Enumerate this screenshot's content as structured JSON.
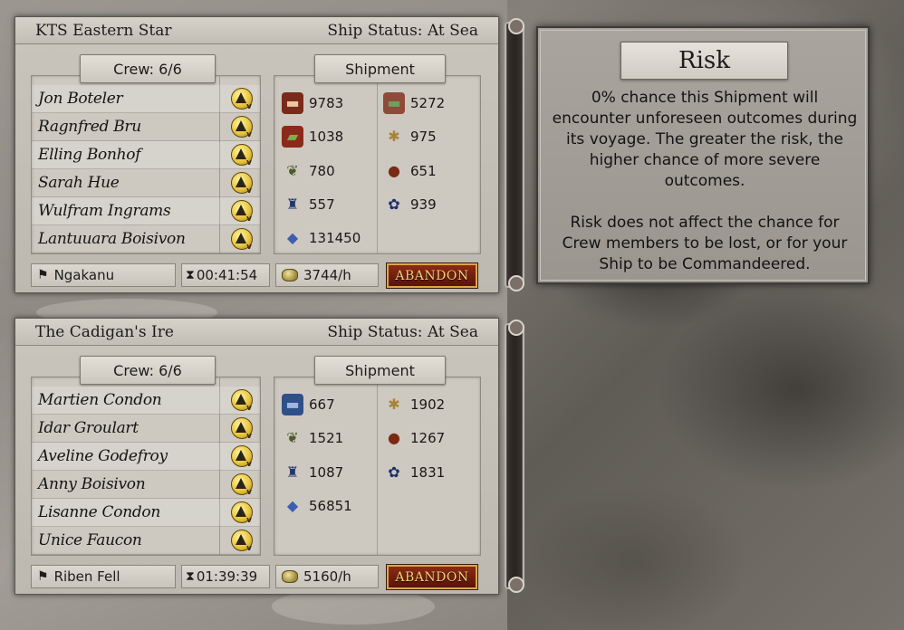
{
  "ships": [
    {
      "name": "KTS Eastern Star",
      "status": "Ship Status: At Sea",
      "crew_label": "Crew: 6/6",
      "shipment_label": "Shipment",
      "crew": [
        "Jon Boteler",
        "Ragnfred Bru",
        "Elling Bonhof",
        "Sarah Hue",
        "Wulfram Ingrams",
        "Lantuuara Boisivon"
      ],
      "cargo_left": [
        {
          "icon": "wood-log-icon",
          "value": "9783"
        },
        {
          "icon": "cloth-bolt-icon",
          "value": "1038"
        },
        {
          "icon": "herb-icon",
          "value": "780"
        },
        {
          "icon": "crystal-flask-icon",
          "value": "557"
        },
        {
          "icon": "gem-pile-icon",
          "value": "131450"
        }
      ],
      "cargo_right": [
        {
          "icon": "plank-icon",
          "value": "5272"
        },
        {
          "icon": "wheat-icon",
          "value": "975"
        },
        {
          "icon": "fruit-icon",
          "value": "651"
        },
        {
          "icon": "ore-cluster-icon",
          "value": "939"
        }
      ],
      "destination": "Ngakanu",
      "timer": "00:41:54",
      "rate": "3744/h",
      "abandon_label": "ABANDON"
    },
    {
      "name": "The Cadigan's Ire",
      "status": "Ship Status: At Sea",
      "crew_label": "Crew: 6/6",
      "shipment_label": "Shipment",
      "crew": [
        "Martien Condon",
        "Idar Groulart",
        "Aveline Godefroy",
        "Anny Boisivon",
        "Lisanne Condon",
        "Unice Faucon"
      ],
      "cargo_left": [
        {
          "icon": "steel-bar-icon",
          "value": "667"
        },
        {
          "icon": "herb-icon",
          "value": "1521"
        },
        {
          "icon": "crystal-flask-icon",
          "value": "1087"
        },
        {
          "icon": "gem-pile-icon",
          "value": "56851"
        }
      ],
      "cargo_right": [
        {
          "icon": "wheat-icon",
          "value": "1902"
        },
        {
          "icon": "fruit-icon",
          "value": "1267"
        },
        {
          "icon": "ore-cluster-icon",
          "value": "1831"
        }
      ],
      "destination": "Riben Fell",
      "timer": "01:39:39",
      "rate": "5160/h",
      "abandon_label": "ABANDON"
    }
  ],
  "risk": {
    "title": "Risk",
    "paragraph_1": "0% chance this Shipment will encounter unforeseen outcomes during its voyage. The greater the risk, the higher chance of more severe outcomes.",
    "paragraph_2": "Risk does not affect the chance for Crew members to be lost, or for your Ship to be Commandeered."
  },
  "colors": {
    "panel": "#c9c5bd",
    "abandon_bg": "#7a2410",
    "abandon_text": "#f3d27a",
    "badge_gold": "#e9c640"
  }
}
